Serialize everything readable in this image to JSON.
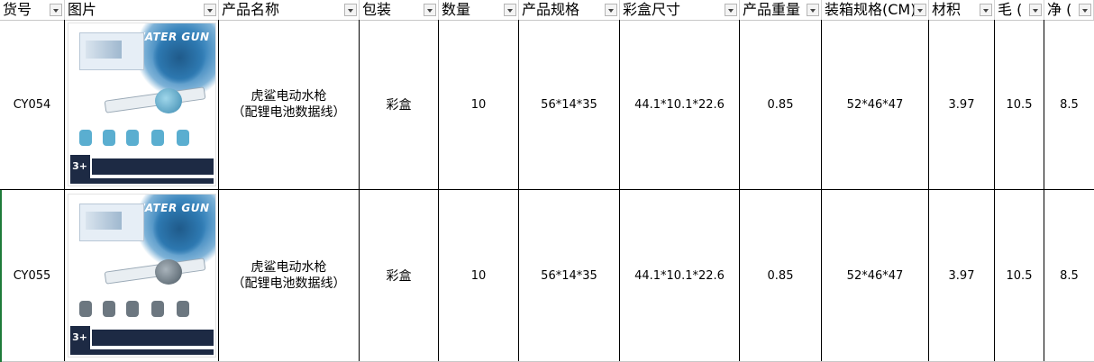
{
  "columns": [
    {
      "label": "货号"
    },
    {
      "label": "图片"
    },
    {
      "label": "产品名称"
    },
    {
      "label": "包装"
    },
    {
      "label": "数量"
    },
    {
      "label": "产品规格"
    },
    {
      "label": "彩盒尺寸"
    },
    {
      "label": "产品重量"
    },
    {
      "label": "装箱规格(CM)"
    },
    {
      "label": "材积"
    },
    {
      "label": "毛 ("
    },
    {
      "label": "净 ("
    }
  ],
  "rows": [
    {
      "sku": "CY054",
      "name_line1": "虎鲨电动水枪",
      "name_line2": "（配锂电池数据线）",
      "packaging": "彩盒",
      "quantity": "10",
      "product_spec": "56*14*35",
      "box_size": "44.1*10.1*22.6",
      "weight": "0.85",
      "carton_spec": "52*46*47",
      "volume": "3.97",
      "gross": "10.5",
      "net": "8.5",
      "image_brand": "WATER GUN",
      "image_age": "3+"
    },
    {
      "sku": "CY055",
      "name_line1": "虎鲨电动水枪",
      "name_line2": "（配锂电池数据线）",
      "packaging": "彩盒",
      "quantity": "10",
      "product_spec": "56*14*35",
      "box_size": "44.1*10.1*22.6",
      "weight": "0.85",
      "carton_spec": "52*46*47",
      "volume": "3.97",
      "gross": "10.5",
      "net": "8.5",
      "image_brand": "WATER GUN",
      "image_age": "3+"
    }
  ],
  "icons": {
    "filter": "filter-dropdown-icon"
  },
  "colors": {
    "selection_border": "#1e7b3a",
    "grid": "#000000",
    "image_blue": "#2f6fa3"
  }
}
